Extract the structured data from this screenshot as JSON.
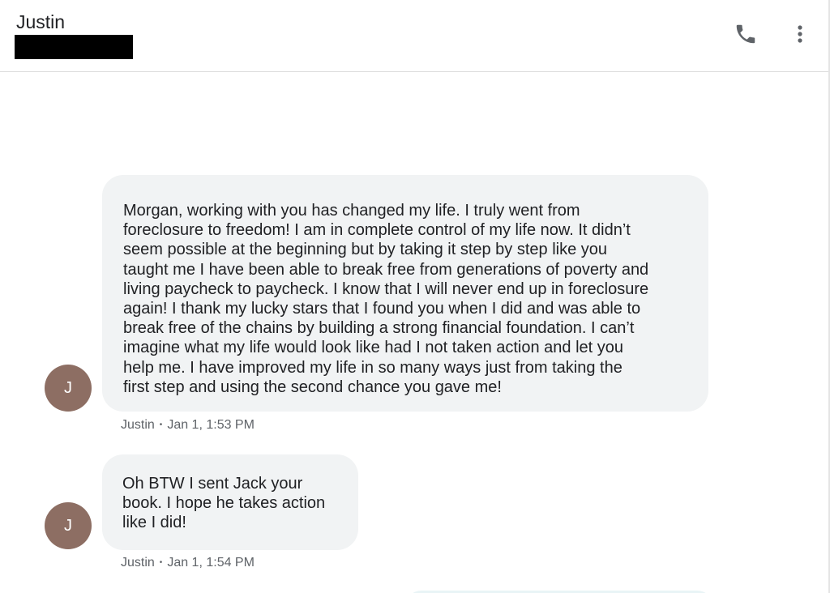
{
  "header": {
    "contact_name": "Justin",
    "icons": {
      "call": "phone-icon",
      "more": "more-vert-icon"
    }
  },
  "messages": [
    {
      "sender": "Justin",
      "avatar_initial": "J",
      "avatar_color": "#8d6e63",
      "lines": [
        "Morgan, working with you has changed my life. I truly went from",
        "foreclosure to freedom! I am in complete control of my life now. It didn’t",
        "seem possible at the beginning but by taking it step by step like you",
        "taught me I have been able to break free from generations of poverty and",
        "living paycheck to paycheck. I know that I will never end up in foreclosure",
        "again! I thank my lucky stars that I found you when I did and was able to",
        "break free of the chains by building a strong financial foundation. I can’t",
        "imagine what my life would look like had I not taken action and let you",
        "help me. I have improved my life in so many ways just from taking the",
        "first step and using the second chance you gave me!"
      ],
      "time": "Jan 1, 1:53 PM"
    },
    {
      "sender": "Justin",
      "avatar_initial": "J",
      "avatar_color": "#8d6e63",
      "lines": [
        "Oh BTW I sent Jack your",
        "book. I hope he takes action",
        "like I did!"
      ],
      "time": "Jan 1, 1:54 PM"
    }
  ],
  "colors": {
    "bubble_incoming": "#f1f3f4",
    "text_primary": "#202124",
    "text_secondary": "#5f6368",
    "divider": "#dcdcdc"
  }
}
